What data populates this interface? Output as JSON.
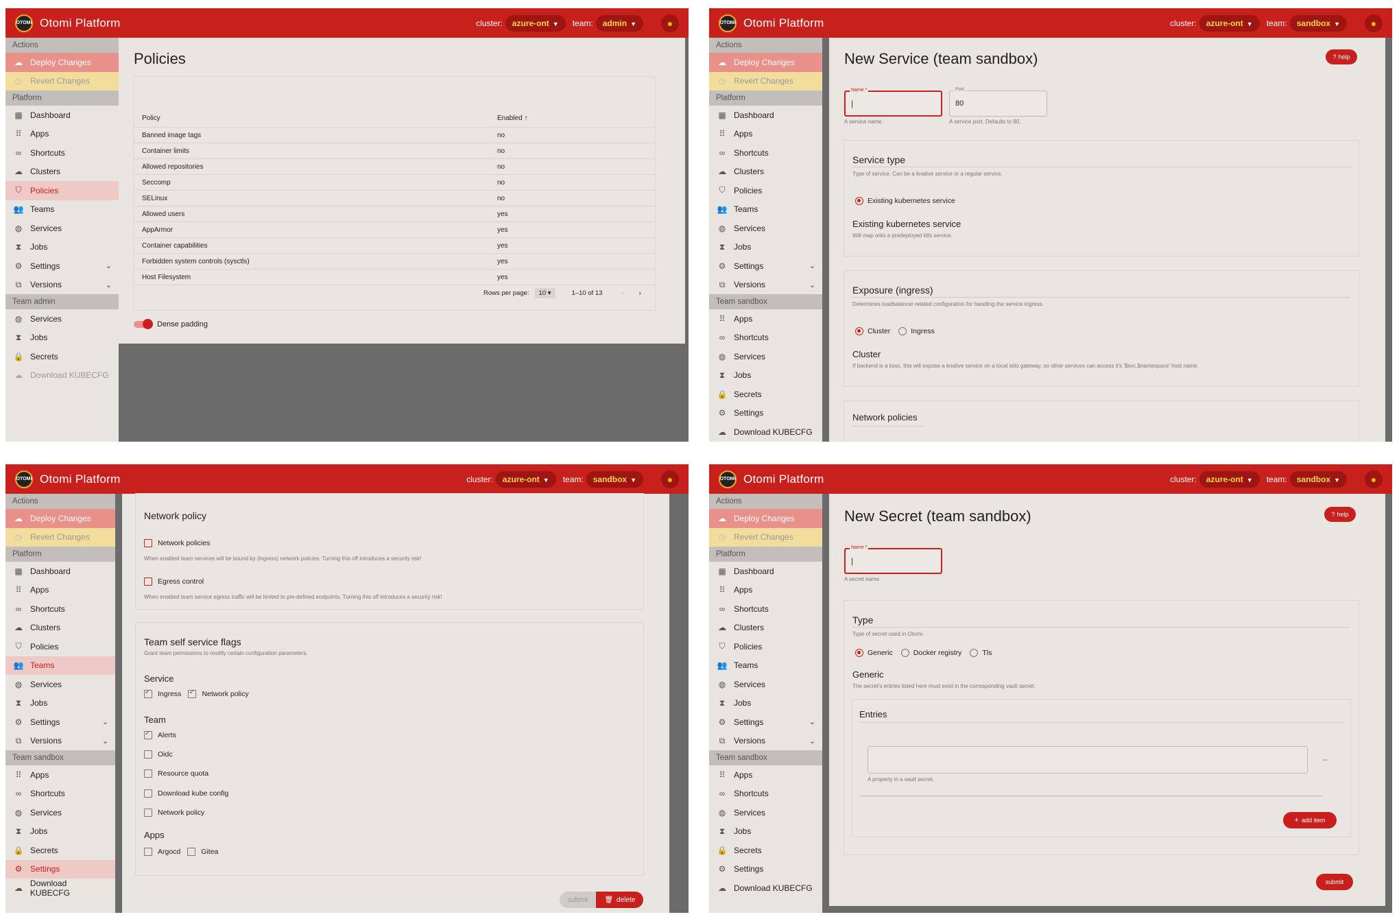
{
  "appbar": {
    "logo_text": "OTOMI",
    "brand": "Otomi Platform",
    "cluster_label": "cluster:",
    "team_label": "team:",
    "cluster_value": "azure-ont",
    "team_admin": "admin",
    "team_sandbox": "sandbox"
  },
  "sidebar": {
    "actions": "Actions",
    "deploy": "Deploy Changes",
    "revert": "Revert Changes",
    "platform": "Platform",
    "dashboard": "Dashboard",
    "apps": "Apps",
    "shortcuts": "Shortcuts",
    "clusters": "Clusters",
    "policies": "Policies",
    "teams": "Teams",
    "services": "Services",
    "jobs": "Jobs",
    "settings": "Settings",
    "versions": "Versions",
    "team_admin": "Team admin",
    "team_sandbox": "Team sandbox",
    "secrets": "Secrets",
    "download": "Download KUBECFG"
  },
  "policies_page": {
    "title": "Policies",
    "col_policy": "Policy",
    "col_enabled": "Enabled",
    "sort_icon": "↑",
    "rows": [
      {
        "name": "Banned image tags",
        "enabled": "no"
      },
      {
        "name": "Container limits",
        "enabled": "no"
      },
      {
        "name": "Allowed repositories",
        "enabled": "no"
      },
      {
        "name": "Seccomp",
        "enabled": "no"
      },
      {
        "name": "SELinux",
        "enabled": "no"
      },
      {
        "name": "Allowed users",
        "enabled": "yes"
      },
      {
        "name": "AppArmor",
        "enabled": "yes"
      },
      {
        "name": "Container capabilities",
        "enabled": "yes"
      },
      {
        "name": "Forbidden system controls (sysctls)",
        "enabled": "yes"
      },
      {
        "name": "Host Filesystem",
        "enabled": "yes"
      }
    ],
    "rows_per_page_label": "Rows per page:",
    "rows_per_page": "10",
    "range": "1–10 of 13",
    "dense": "Dense padding"
  },
  "service_page": {
    "title": "New Service (team sandbox)",
    "help": "help",
    "name_label": "Name *",
    "name_helper": "A service name.",
    "port_label": "Port",
    "port_value": "80",
    "port_helper": "A service port. Defaults to 80.",
    "svc_type_title": "Service type",
    "svc_type_desc": "Type of service. Can be a knative service or a regular service.",
    "existing_option": "Existing kubernetes service",
    "existing_title": "Existing kubernetes service",
    "existing_desc": "Will map onto a predeployed k8s service.",
    "exposure_title": "Exposure (ingress)",
    "exposure_desc": "Determines loadbalancer related configuration for handling the service ingress.",
    "opt_cluster": "Cluster",
    "opt_ingress": "Ingress",
    "cluster_title": "Cluster",
    "cluster_desc": "If backend is a ksvc, this will expose a knative service on a local istio gateway, so other services can access it's '$svc.$namespace' host name.",
    "netpol_title": "Network policies"
  },
  "team_settings_page": {
    "netpol_title": "Network policy",
    "netpol_cb": "Network policies",
    "netpol_desc": "When enabled team services will be bound by (ingress) network policies. Turning this off introduces a security risk!",
    "egress_cb": "Egress control",
    "egress_desc": "When enabled team service egress traffic will be limited to pre-defined endpoints. Turning this off introduces a security risk!",
    "flags_title": "Team self service flags",
    "flags_desc": "Grant team permissions to modify certain configuration parameters.",
    "service_h": "Service",
    "ingress": "Ingress",
    "network_policy": "Network policy",
    "team_h": "Team",
    "alerts": "Alerts",
    "oidc": "Oidc",
    "resource_quota": "Resource quota",
    "download_kube": "Download kube config",
    "team_netpol": "Network policy",
    "apps_h": "Apps",
    "argocd": "Argocd",
    "gitea": "Gitea",
    "submit": "submit",
    "delete": "delete"
  },
  "secret_page": {
    "title": "New Secret (team sandbox)",
    "help": "help",
    "name_label": "Name *",
    "name_helper": "A secret name",
    "type_title": "Type",
    "type_desc": "Type of secret used in Otomi.",
    "opt_generic": "Generic",
    "opt_docker": "Docker registry",
    "opt_tls": "Tls",
    "generic_title": "Generic",
    "generic_desc": "The secret's entries listed here must exist in the corresponding vault secret.",
    "entries_title": "Entries",
    "entry_helper": "A property in a vault secret.",
    "minus": "–",
    "add_item": "add item",
    "submit": "submit"
  },
  "colors": {
    "primary": "#c8201c",
    "accent": "#ffd54a",
    "deploy": "#e9908b",
    "revert": "#f3dd9d"
  }
}
